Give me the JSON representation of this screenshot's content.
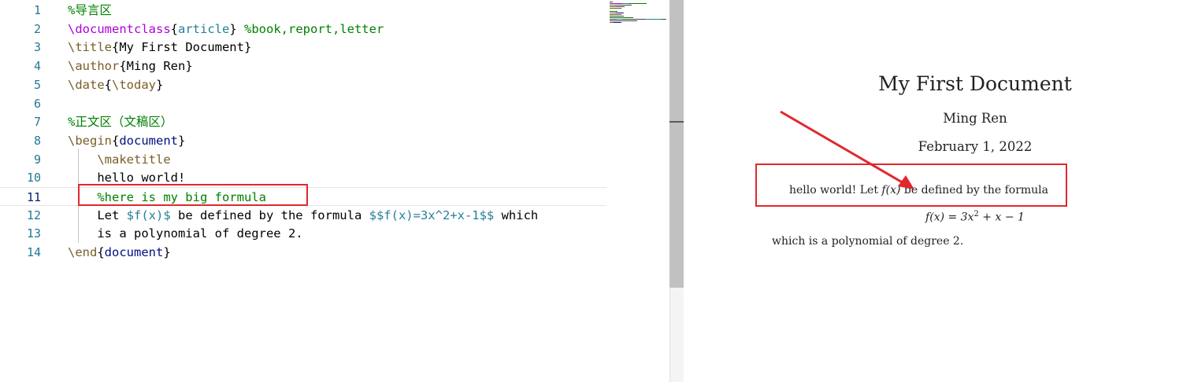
{
  "editor": {
    "lines": [
      {
        "num": "1",
        "parts": [
          {
            "t": "%导言区",
            "c": "comment"
          }
        ]
      },
      {
        "num": "2",
        "parts": [
          {
            "t": "\\documentclass",
            "c": "cls"
          },
          {
            "t": "{",
            "c": "brace"
          },
          {
            "t": "article",
            "c": "arg"
          },
          {
            "t": "}",
            "c": "brace"
          },
          {
            "t": " %book,report,letter",
            "c": "comment"
          }
        ]
      },
      {
        "num": "3",
        "parts": [
          {
            "t": "\\title",
            "c": "cmd"
          },
          {
            "t": "{My First Document}",
            "c": "text"
          }
        ]
      },
      {
        "num": "4",
        "parts": [
          {
            "t": "\\author",
            "c": "cmd"
          },
          {
            "t": "{Ming Ren}",
            "c": "text"
          }
        ]
      },
      {
        "num": "5",
        "parts": [
          {
            "t": "\\date",
            "c": "cmd"
          },
          {
            "t": "{",
            "c": "brace"
          },
          {
            "t": "\\today",
            "c": "cmd"
          },
          {
            "t": "}",
            "c": "brace"
          }
        ]
      },
      {
        "num": "6",
        "parts": []
      },
      {
        "num": "7",
        "parts": [
          {
            "t": "%正文区（文稿区）",
            "c": "comment"
          }
        ]
      },
      {
        "num": "8",
        "parts": [
          {
            "t": "\\begin",
            "c": "cmd"
          },
          {
            "t": "{",
            "c": "brace"
          },
          {
            "t": "document",
            "c": "env"
          },
          {
            "t": "}",
            "c": "brace"
          }
        ]
      },
      {
        "num": "9",
        "parts": [
          {
            "t": "    \\maketitle",
            "c": "cmd"
          }
        ]
      },
      {
        "num": "10",
        "parts": [
          {
            "t": "    hello world!",
            "c": "text"
          }
        ]
      },
      {
        "num": "11",
        "parts": [
          {
            "t": "    %here is my big formula",
            "c": "comment"
          }
        ],
        "current": true
      },
      {
        "num": "12",
        "parts": [
          {
            "t": "    Let ",
            "c": "text"
          },
          {
            "t": "$f(x)$",
            "c": "math"
          },
          {
            "t": " be defined by the formula ",
            "c": "text"
          },
          {
            "t": "$$f(x)=3x^2+x-1$$",
            "c": "math"
          },
          {
            "t": " which",
            "c": "text"
          }
        ]
      },
      {
        "num": "13",
        "parts": [
          {
            "t": "    is a polynomial of degree 2.",
            "c": "text"
          }
        ]
      },
      {
        "num": "14",
        "parts": [
          {
            "t": "\\end",
            "c": "cmd"
          },
          {
            "t": "{",
            "c": "brace"
          },
          {
            "t": "document",
            "c": "env"
          },
          {
            "t": "}",
            "c": "brace"
          }
        ]
      }
    ]
  },
  "preview": {
    "title": "My First Document",
    "author": "Ming Ren",
    "date": "February 1, 2022",
    "body_text": "hello world! Let",
    "inline_math": "f(x)",
    "body_text_rest": "be defined by the formula",
    "formula_lhs": "f(x) = 3x",
    "formula_exp": "2",
    "formula_rhs": " + x − 1",
    "body_text_2": "which is a polynomial of degree 2."
  },
  "colors": {
    "annotation": "#e0282d",
    "comment": "#008000",
    "command": "#795e26",
    "documentclass": "#af00db",
    "argument": "#267f99",
    "environment": "#001080",
    "line_number": "#237893"
  }
}
